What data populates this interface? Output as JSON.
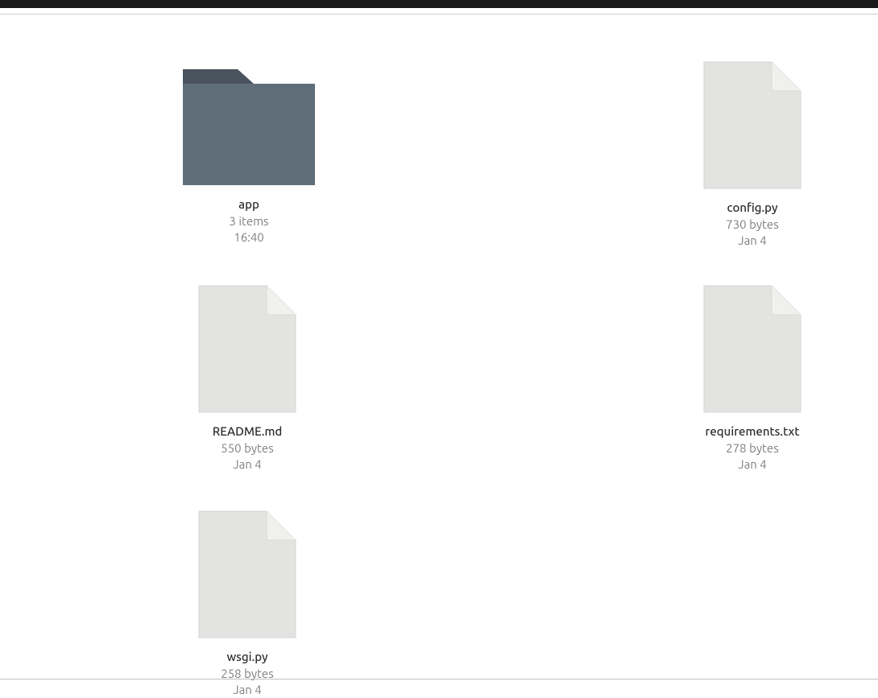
{
  "items": [
    {
      "name": "app",
      "meta1": "3 items",
      "meta2": "16:40",
      "type": "folder"
    },
    {
      "name": "config.py",
      "meta1": "730 bytes",
      "meta2": "Jan 4",
      "type": "file"
    },
    {
      "name": "README.md",
      "meta1": "550 bytes",
      "meta2": "Jan 4",
      "type": "file"
    },
    {
      "name": "requirements.txt",
      "meta1": "278 bytes",
      "meta2": "Jan 4",
      "type": "file"
    },
    {
      "name": "wsgi.py",
      "meta1": "258 bytes",
      "meta2": "Jan 4",
      "type": "file"
    }
  ]
}
